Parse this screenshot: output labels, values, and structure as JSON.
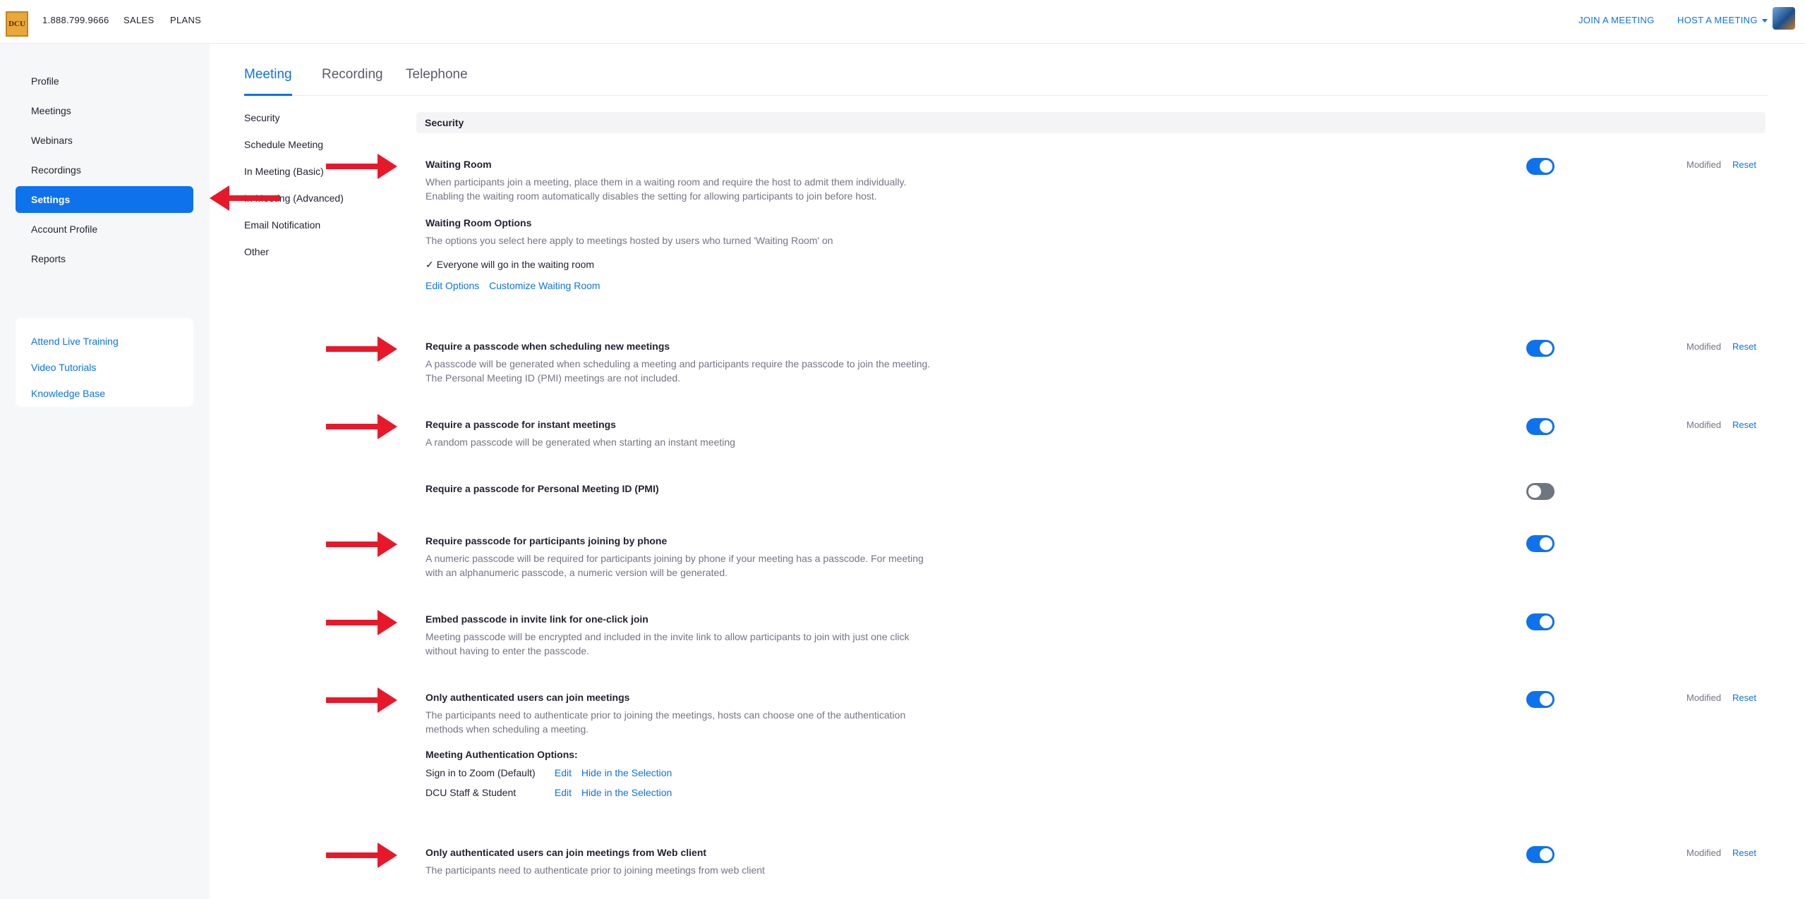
{
  "topbar": {
    "logo_text": "DCU",
    "phone": "1.888.799.9666",
    "sales": "SALES",
    "plans": "PLANS",
    "join_meeting": "JOIN A MEETING",
    "host_meeting": "HOST A MEETING"
  },
  "sidebar": {
    "items": [
      {
        "label": "Profile"
      },
      {
        "label": "Meetings"
      },
      {
        "label": "Webinars"
      },
      {
        "label": "Recordings"
      },
      {
        "label": "Settings"
      },
      {
        "label": "Account Profile"
      },
      {
        "label": "Reports"
      }
    ],
    "active_item": "Settings",
    "help_links": [
      {
        "label": "Attend Live Training"
      },
      {
        "label": "Video Tutorials"
      },
      {
        "label": "Knowledge Base"
      }
    ]
  },
  "tabs": [
    {
      "label": "Meeting"
    },
    {
      "label": "Recording"
    },
    {
      "label": "Telephone"
    }
  ],
  "active_tab": "Meeting",
  "subnav": [
    {
      "label": "Security"
    },
    {
      "label": "Schedule Meeting"
    },
    {
      "label": "In Meeting (Basic)"
    },
    {
      "label": "In Meeting (Advanced)"
    },
    {
      "label": "Email Notification"
    },
    {
      "label": "Other"
    }
  ],
  "section_title": "Security",
  "modified_label": "Modified",
  "reset_label": "Reset",
  "settings": {
    "waiting_room": {
      "title": "Waiting Room",
      "desc": "When participants join a meeting, place them in a waiting room and require the host to admit them individually. Enabling the waiting room automatically disables the setting for allowing participants to join before host.",
      "options_title": "Waiting Room Options",
      "options_desc": "The options you select here apply to meetings hosted by users who turned 'Waiting Room' on",
      "check_mark": "✓",
      "check_item": "Everyone will go in the waiting room",
      "edit_options": "Edit Options",
      "customize": "Customize Waiting Room",
      "enabled": true
    },
    "passcode_scheduling": {
      "title": "Require a passcode when scheduling new meetings",
      "desc": "A passcode will be generated when scheduling a meeting and participants require the passcode to join the meeting. The Personal Meeting ID (PMI) meetings are not included.",
      "enabled": true
    },
    "passcode_instant": {
      "title": "Require a passcode for instant meetings",
      "desc": "A random passcode will be generated when starting an instant meeting",
      "enabled": true
    },
    "passcode_pmi": {
      "title": "Require a passcode for Personal Meeting ID (PMI)",
      "enabled": false
    },
    "passcode_phone": {
      "title": "Require passcode for participants joining by phone",
      "desc": "A numeric passcode will be required for participants joining by phone if your meeting has a passcode. For meeting with an alphanumeric passcode, a numeric version will be generated.",
      "enabled": true
    },
    "embed_passcode": {
      "title": "Embed passcode in invite link for one-click join",
      "desc": "Meeting passcode will be encrypted and included in the invite link to allow participants to join with just one click without having to enter the passcode.",
      "enabled": true
    },
    "auth_users": {
      "title": "Only authenticated users can join meetings",
      "desc": "The participants need to authenticate prior to joining the meetings, hosts can choose one of the authentication methods when scheduling a meeting.",
      "options_title": "Meeting Authentication Options:",
      "options": [
        {
          "name": "Sign in to Zoom (Default)",
          "edit": "Edit",
          "hide": "Hide in the Selection"
        },
        {
          "name": "DCU Staff & Student",
          "edit": "Edit",
          "hide": "Hide in the Selection"
        }
      ],
      "enabled": true
    },
    "auth_web": {
      "title": "Only authenticated users can join meetings from Web client",
      "desc": "The participants need to authenticate prior to joining meetings from web client",
      "enabled": true
    }
  },
  "colors": {
    "accent": "#0e72ed",
    "arrow": "#e8182b",
    "toggle_off": "#6e7680"
  }
}
